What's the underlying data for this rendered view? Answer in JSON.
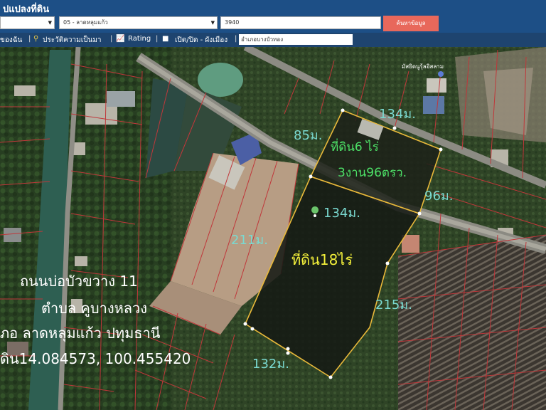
{
  "header": {
    "title": "ปแปลงที่ดิน",
    "district_select": "05 - ลาดหลุมแก้ว",
    "parcel_input": "3940",
    "search_button": "ค้นหาข้อมูล"
  },
  "toolbar": {
    "item1": "ของฉัน",
    "item2": "ประวัติความเป็นมา",
    "item3": "Rating",
    "item4": "เปิด/ปิด - ผังเมือง",
    "address_input": "อำเภอบางบัวทอง"
  },
  "map": {
    "plot_small_label_line1": "ที่ดิน6 ไร่",
    "plot_small_label_line2": "3งาน96ตรว.",
    "plot_large_label": "ที่ดิน18ไร่",
    "dim_85": "85ม.",
    "dim_134_top": "134ม.",
    "dim_96": "96ม.",
    "dim_134_mid": "134ม.",
    "dim_211": "211ม.",
    "dim_215": "215ม.",
    "dim_132": "132ม.",
    "place_label": "มัสยิดนูรุ้ลอิสลาม",
    "info_line1": "ถนนบ่อบัวขวาง 11",
    "info_line2": "ตำบล คูบางหลวง",
    "info_line3": "ภอ ลาดหลุมแก้ว ปทุมธานี",
    "info_line4": "ดิน14.084573, 100.455420"
  }
}
